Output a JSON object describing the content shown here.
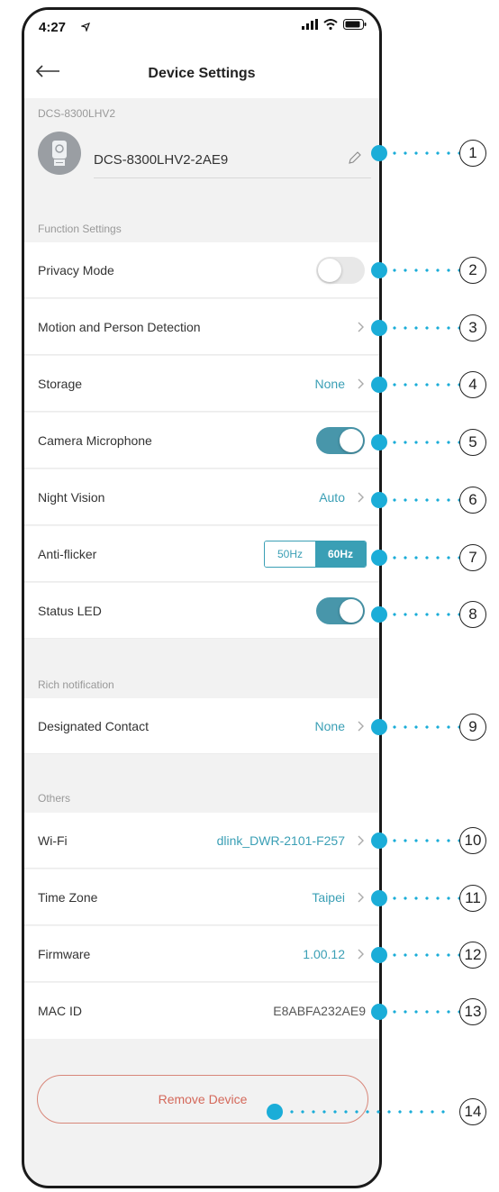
{
  "status": {
    "time": "4:27"
  },
  "nav": {
    "title": "Device Settings"
  },
  "device": {
    "model_label": "DCS-8300LHV2",
    "name": "DCS-8300LHV2-2AE9"
  },
  "sections": {
    "function": "Function Settings",
    "rich": "Rich notification",
    "others": "Others"
  },
  "rows": {
    "privacy": {
      "label": "Privacy Mode",
      "on": false
    },
    "motion": {
      "label": "Motion and Person Detection"
    },
    "storage": {
      "label": "Storage",
      "value": "None"
    },
    "mic": {
      "label": "Camera Microphone",
      "on": true
    },
    "night": {
      "label": "Night Vision",
      "value": "Auto"
    },
    "flicker": {
      "label": "Anti-flicker",
      "opt_a": "50Hz",
      "opt_b": "60Hz",
      "selected": "60Hz"
    },
    "led": {
      "label": "Status LED",
      "on": true
    },
    "contact": {
      "label": "Designated Contact",
      "value": "None"
    },
    "wifi": {
      "label": "Wi-Fi",
      "value": "dlink_DWR-2101-F257"
    },
    "tz": {
      "label": "Time Zone",
      "value": "Taipei"
    },
    "fw": {
      "label": "Firmware",
      "value": "1.00.12"
    },
    "mac": {
      "label": "MAC ID",
      "value": "E8ABFA232AE9"
    }
  },
  "remove_label": "Remove Device",
  "callouts": [
    "1",
    "2",
    "3",
    "4",
    "5",
    "6",
    "7",
    "8",
    "9",
    "10",
    "11",
    "12",
    "13",
    "14"
  ],
  "colors": {
    "accent": "#3a9fb5",
    "toggle_on": "#4896aa",
    "callout": "#1badd8",
    "danger": "#d4685a"
  }
}
